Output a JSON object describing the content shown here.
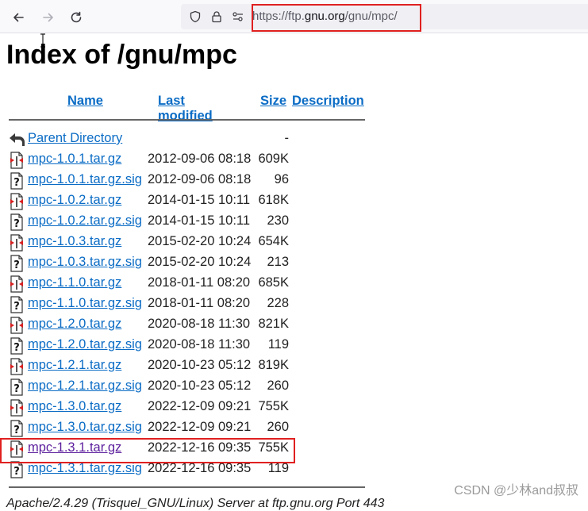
{
  "browser": {
    "url_prefix": "https://ftp.",
    "url_host": "gnu.org",
    "url_path": "/gnu/mpc/"
  },
  "page": {
    "title": "Index of /gnu/mpc",
    "columns": {
      "name": "Name",
      "last_modified": "Last modified",
      "size": "Size",
      "description": "Description"
    },
    "parent": {
      "name": "Parent Directory",
      "size": "-"
    },
    "files": [
      {
        "name": "mpc-1.0.1.tar.gz",
        "date": "2012-09-06 08:18",
        "size": "609K",
        "kind": "archive"
      },
      {
        "name": "mpc-1.0.1.tar.gz.sig",
        "date": "2012-09-06 08:18",
        "size": "96",
        "kind": "unknown"
      },
      {
        "name": "mpc-1.0.2.tar.gz",
        "date": "2014-01-15 10:11",
        "size": "618K",
        "kind": "archive"
      },
      {
        "name": "mpc-1.0.2.tar.gz.sig",
        "date": "2014-01-15 10:11",
        "size": "230",
        "kind": "unknown"
      },
      {
        "name": "mpc-1.0.3.tar.gz",
        "date": "2015-02-20 10:24",
        "size": "654K",
        "kind": "archive"
      },
      {
        "name": "mpc-1.0.3.tar.gz.sig",
        "date": "2015-02-20 10:24",
        "size": "213",
        "kind": "unknown"
      },
      {
        "name": "mpc-1.1.0.tar.gz",
        "date": "2018-01-11 08:20",
        "size": "685K",
        "kind": "archive"
      },
      {
        "name": "mpc-1.1.0.tar.gz.sig",
        "date": "2018-01-11 08:20",
        "size": "228",
        "kind": "unknown"
      },
      {
        "name": "mpc-1.2.0.tar.gz",
        "date": "2020-08-18 11:30",
        "size": "821K",
        "kind": "archive"
      },
      {
        "name": "mpc-1.2.0.tar.gz.sig",
        "date": "2020-08-18 11:30",
        "size": "119",
        "kind": "unknown"
      },
      {
        "name": "mpc-1.2.1.tar.gz",
        "date": "2020-10-23 05:12",
        "size": "819K",
        "kind": "archive"
      },
      {
        "name": "mpc-1.2.1.tar.gz.sig",
        "date": "2020-10-23 05:12",
        "size": "260",
        "kind": "unknown"
      },
      {
        "name": "mpc-1.3.0.tar.gz",
        "date": "2022-12-09 09:21",
        "size": "755K",
        "kind": "archive"
      },
      {
        "name": "mpc-1.3.0.tar.gz.sig",
        "date": "2022-12-09 09:21",
        "size": "260",
        "kind": "unknown"
      },
      {
        "name": "mpc-1.3.1.tar.gz",
        "date": "2022-12-16 09:35",
        "size": "755K",
        "kind": "archive",
        "visited": true,
        "highlighted": true
      },
      {
        "name": "mpc-1.3.1.tar.gz.sig",
        "date": "2022-12-16 09:35",
        "size": "119",
        "kind": "unknown"
      }
    ],
    "footer": "Apache/2.4.29 (Trisquel_GNU/Linux) Server at ftp.gnu.org Port 443"
  },
  "watermark": "CSDN @少林and叔叔",
  "colors": {
    "link": "#0b6cc5",
    "visited_link": "#5b1e9c",
    "highlight_box": "#e02020"
  }
}
